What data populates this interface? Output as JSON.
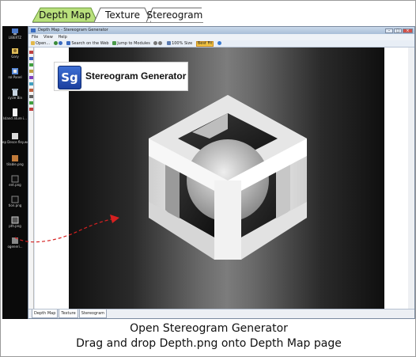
{
  "tutorial_tabs": {
    "tabs": [
      "Depth Map",
      "Texture",
      "Stereogram"
    ],
    "active": "Depth Map",
    "active_color": "#b8e07a"
  },
  "desktop": {
    "icons": [
      {
        "label": "LIBERTZ",
        "icon": "computer-icon"
      },
      {
        "label": "Gary",
        "icon": "user-folder-icon"
      },
      {
        "label": "rol Panel",
        "icon": "control-panel-icon"
      },
      {
        "label": "cycle Bin",
        "icon": "recycle-bin-icon"
      },
      {
        "label": "Island ature i...",
        "icon": "document-icon"
      },
      {
        "label": "ep Desce fley.web",
        "icon": "image-icon"
      },
      {
        "label": "tilable.png",
        "icon": "image-icon"
      },
      {
        "label": "ent.png",
        "icon": "image-icon"
      },
      {
        "label": "tion.png",
        "icon": "image-icon"
      },
      {
        "label": "pth.png",
        "icon": "image-icon"
      },
      {
        "label": "ogeneri...",
        "icon": "image-icon"
      }
    ]
  },
  "window": {
    "title": "Depth Map - Stereogram Generator",
    "menu": [
      "File",
      "View",
      "Help"
    ],
    "toolbar": {
      "open": "Open...",
      "search_web": "Search on the Web",
      "jump_modules": "Jump to Modules",
      "zoom": "100% Size",
      "best_fit": "Best Fit"
    },
    "bottom_tabs": [
      "Depth Map",
      "Texture",
      "Stereogram"
    ]
  },
  "logo": {
    "mark": "Sg",
    "name": "Stereogram Generator"
  },
  "caption": {
    "line1": "Open Stereogram Generator",
    "line2": "Drag and drop Depth.png onto  Depth Map page"
  },
  "colors": {
    "arrow": "#d62020",
    "logo_blue": "#2a55b8"
  }
}
